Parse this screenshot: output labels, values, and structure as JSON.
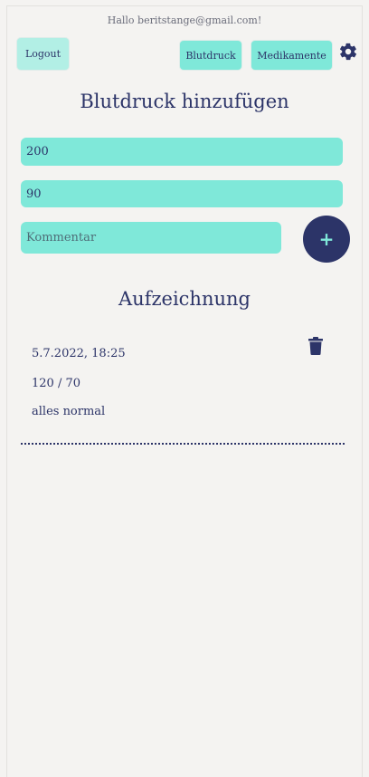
{
  "header": {
    "greeting": "Hallo beritstange@gmail.com!",
    "logout_label": "Logout",
    "nav": {
      "blutdruck_label": "Blutdruck",
      "medikamente_label": "Medikamente"
    },
    "settings_icon": "gear-icon"
  },
  "form": {
    "title": "Blutdruck hinzufügen",
    "systolic_value": "200",
    "diastolic_value": "90",
    "comment_placeholder": "Kommentar",
    "add_button_label": "+"
  },
  "records": {
    "title": "Aufzeichnung",
    "items": [
      {
        "datetime": "5.7.2022, 18:25",
        "values": "120 / 70",
        "comment": "alles normal",
        "delete_icon": "trash-icon"
      }
    ]
  },
  "colors": {
    "accent": "#7fe8d9",
    "primary": "#2c3468",
    "background": "#f4f3f1"
  }
}
